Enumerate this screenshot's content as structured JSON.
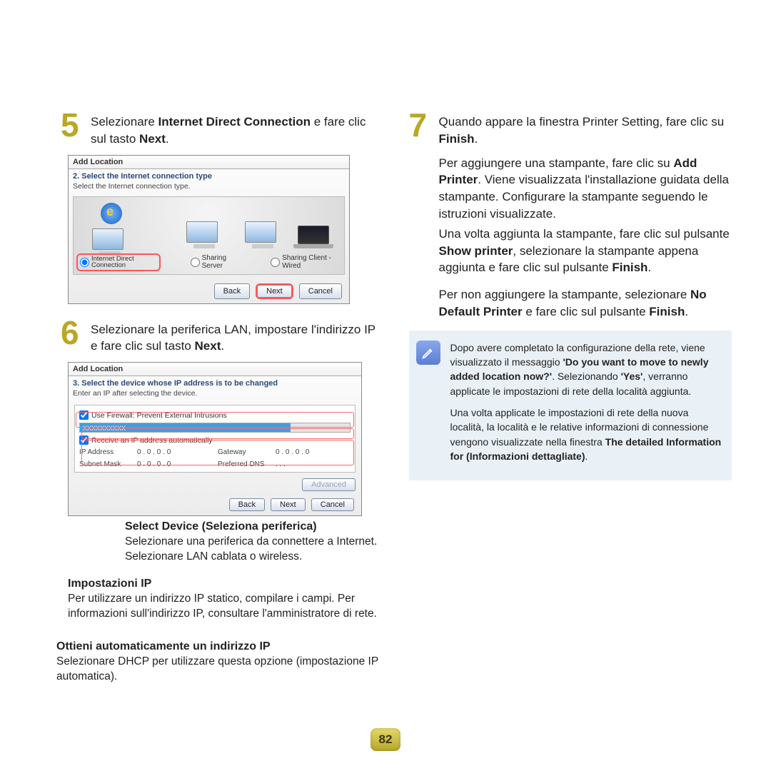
{
  "page_number": "82",
  "steps": {
    "s5": {
      "num": "5",
      "pre": "Selezionare ",
      "bold1": "Internet Direct Connection",
      "mid": " e fare clic sul tasto ",
      "bold2": "Next",
      "post": "."
    },
    "s6": {
      "num": "6",
      "pre": "Selezionare la periferica LAN, impostare l'indirizzo IP e fare clic sul tasto ",
      "bold1": "Next",
      "post": "."
    },
    "s7": {
      "num": "7",
      "pre": "Quando appare la finestra Printer Setting, fare clic su ",
      "bold1": "Finish",
      "post": "."
    }
  },
  "shot1": {
    "title": "Add Location",
    "subtitle": "2. Select the Internet connection type",
    "instruction": "Select the Internet connection type.",
    "opt1": "Internet Direct Connection",
    "opt2": "Sharing Server",
    "opt3": "Sharing Client - Wired",
    "btn_back": "Back",
    "btn_next": "Next",
    "btn_cancel": "Cancel"
  },
  "shot2": {
    "title": "Add Location",
    "subtitle": "3. Select the device whose IP address is to be changed",
    "instruction": "Enter an IP after selecting the device.",
    "firewall": "Use Firewall: Prevent External Intrusions",
    "bar_label": "XXXXXXXXXX",
    "auto_ip": "Receive an IP address automatically",
    "ip_label": "IP Address",
    "subnet_label": "Subnet Mask",
    "gateway_label": "Gateway",
    "dns_label": "Preferred DNS",
    "ip_val": "0 . 0 . 0 . 0",
    "gw_val": "0 . 0 . 0 . 0",
    "sn_val": "0 . 0 . 0 . 0",
    "dns_val": ". . .",
    "btn_adv": "Advanced",
    "btn_back": "Back",
    "btn_next": "Next",
    "btn_cancel": "Cancel"
  },
  "callouts": {
    "c1_title": "Select Device (Seleziona periferica)",
    "c1_text": "Selezionare una periferica da connettere a Internet. Selezionare LAN cablata o wireless.",
    "c2_title": "Impostazioni IP",
    "c2_text": "Per utilizzare un indirizzo IP statico, compilare i campi. Per informazioni sull'indirizzo IP, consultare l'amministratore di rete.",
    "c3_title": "Ottieni automaticamente un indirizzo IP",
    "c3_text": "Selezionare DHCP per utilizzare questa opzione (impostazione IP automatica)."
  },
  "right_paras": {
    "p1_a": "Per aggiungere una stampante, fare clic su ",
    "p1_b": "Add Printer",
    "p1_c": ". Viene visualizzata l'installazione guidata della stampante. Configurare la stampante seguendo le istruzioni visualizzate.",
    "p2_a": "Una volta aggiunta la stampante, fare clic sul pulsante ",
    "p2_b": "Show printer",
    "p2_c": ", selezionare la stampante appena aggiunta e fare clic sul pulsante ",
    "p2_d": "Finish",
    "p2_e": ".",
    "p3_a": "Per non aggiungere la stampante, selezionare ",
    "p3_b": "No Default Printer",
    "p3_c": " e fare clic sul pulsante ",
    "p3_d": "Finish",
    "p3_e": "."
  },
  "note": {
    "p1_a": "Dopo avere completato la configurazione della rete, viene visualizzato il messaggio ",
    "p1_b": "'Do you want to move to newly added location now?'",
    "p1_c": ". Selezionando ",
    "p1_d": "'Yes'",
    "p1_e": ", verranno applicate le impostazioni di rete della località aggiunta.",
    "p2_a": "Una volta applicate le impostazioni di rete della nuova località, la località e le relative informazioni di connessione vengono visualizzate nella finestra ",
    "p2_b": "The detailed Information for (Informazioni dettagliate)",
    "p2_c": "."
  }
}
